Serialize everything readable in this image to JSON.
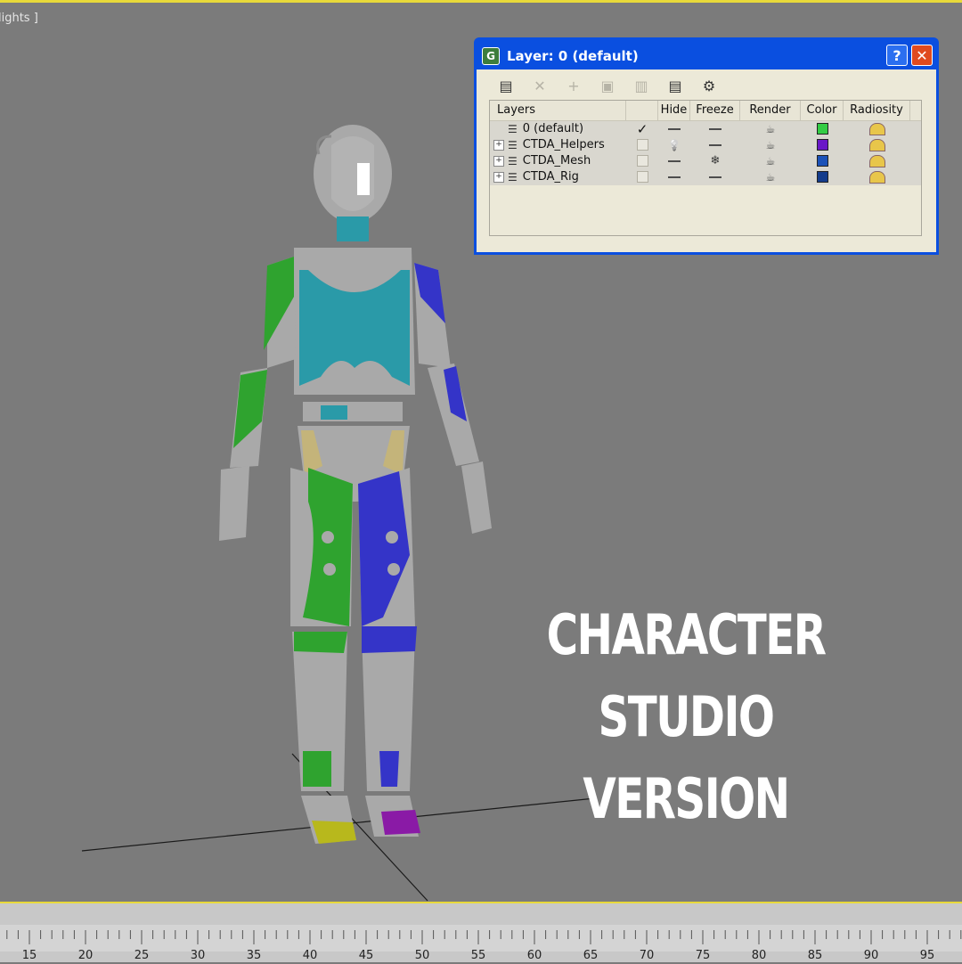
{
  "viewport": {
    "label": "lights ]"
  },
  "overlay": {
    "line1": "CHARACTER",
    "line2": "STUDIO VERSION"
  },
  "layer_dialog": {
    "title": "Layer: 0 (default)",
    "help": "?",
    "close": "✕",
    "toolbar": [
      {
        "name": "create-layer-icon",
        "glyph": "▤",
        "enabled": true
      },
      {
        "name": "delete-layer-icon",
        "glyph": "✕",
        "enabled": false
      },
      {
        "name": "add-to-layer-icon",
        "glyph": "+",
        "enabled": false
      },
      {
        "name": "select-objects-icon",
        "glyph": "▣",
        "enabled": false
      },
      {
        "name": "highlight-layer-icon",
        "glyph": "▥",
        "enabled": false
      },
      {
        "name": "hide-freeze-all-icon",
        "glyph": "▤",
        "enabled": true
      },
      {
        "name": "layer-properties-icon",
        "glyph": "⚙",
        "enabled": true
      }
    ],
    "columns": {
      "layers": "Layers",
      "hide": "Hide",
      "freeze": "Freeze",
      "render": "Render",
      "color": "Color",
      "radiosity": "Radiosity"
    },
    "rows": [
      {
        "name": "0 (default)",
        "expandable": false,
        "active": true,
        "hide": "dash",
        "freeze": "dash",
        "color": "#33cc44"
      },
      {
        "name": "CTDA_Helpers",
        "expandable": true,
        "active": false,
        "hide": "bulb",
        "freeze": "dash",
        "color": "#6a18c8"
      },
      {
        "name": "CTDA_Mesh",
        "expandable": true,
        "active": false,
        "hide": "dash",
        "freeze": "snowflake",
        "color": "#1c52b8"
      },
      {
        "name": "CTDA_Rig",
        "expandable": true,
        "active": false,
        "hide": "dash",
        "freeze": "dash",
        "color": "#143c8c"
      }
    ]
  },
  "timeline": {
    "labels": [
      15,
      20,
      25,
      30,
      35,
      40,
      45,
      50,
      55,
      60,
      65,
      70,
      75,
      80,
      85,
      90,
      95
    ]
  },
  "colors": {
    "frame_accent": "#e8d93a",
    "viewport_bg": "#7b7b7b",
    "dialog_border": "#0a4fe0"
  }
}
